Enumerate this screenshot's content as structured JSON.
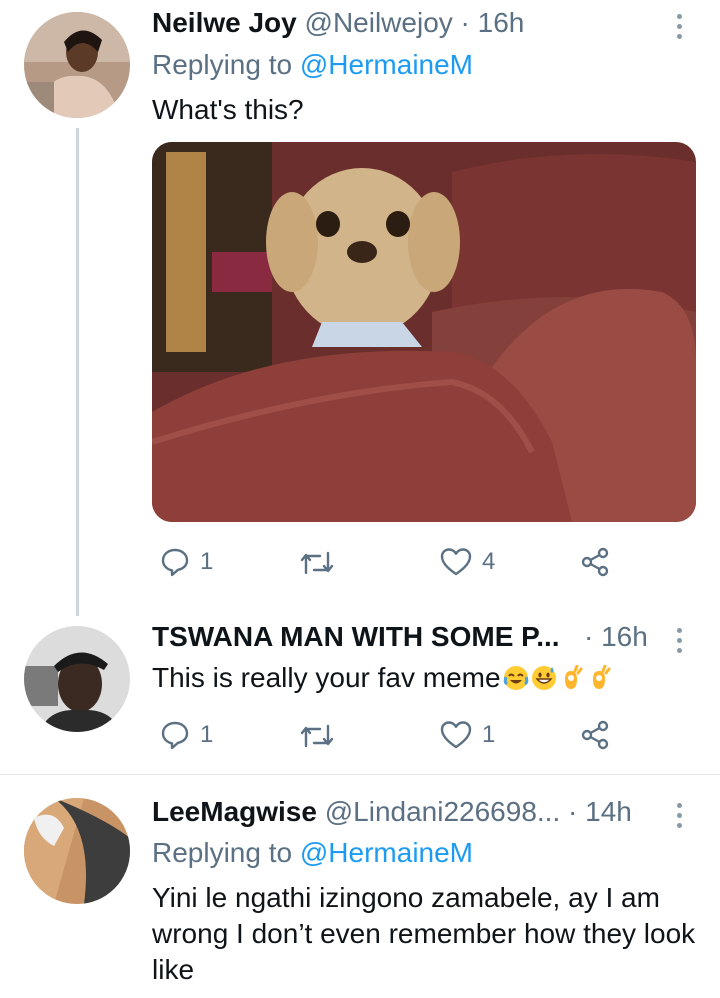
{
  "tweets": [
    {
      "display_name": "Neilwe Joy",
      "handle": "@Neilwejoy",
      "time": "· 16h",
      "reply_prefix": "Replying to ",
      "reply_to": "@HermaineM",
      "text": "What's this?",
      "reply_count": "1",
      "retweet_count": "",
      "like_count": "4"
    },
    {
      "display_name": "TSWANA MAN WITH SOME P...",
      "time": "· 16h",
      "text": "This is really your fav meme",
      "emojis": [
        "face-with-tears-of-joy",
        "grinning-sweat",
        "ok-hand",
        "ok-hand"
      ],
      "reply_count": "1",
      "retweet_count": "",
      "like_count": "1"
    },
    {
      "display_name": "LeeMagwise",
      "handle": "@Lindani226698...",
      "time": "· 14h",
      "reply_prefix": "Replying to ",
      "reply_to": "@HermaineM",
      "text": "Yini le ngathi izingono zamabele, ay I am wrong I don’t even remember how they look like"
    }
  ],
  "colors": {
    "link": "#1d9bf0",
    "muted": "#5b7083",
    "thread_line": "#ccd6dd"
  },
  "icons": [
    "reply-icon",
    "retweet-icon",
    "like-icon",
    "share-icon",
    "more-icon"
  ]
}
